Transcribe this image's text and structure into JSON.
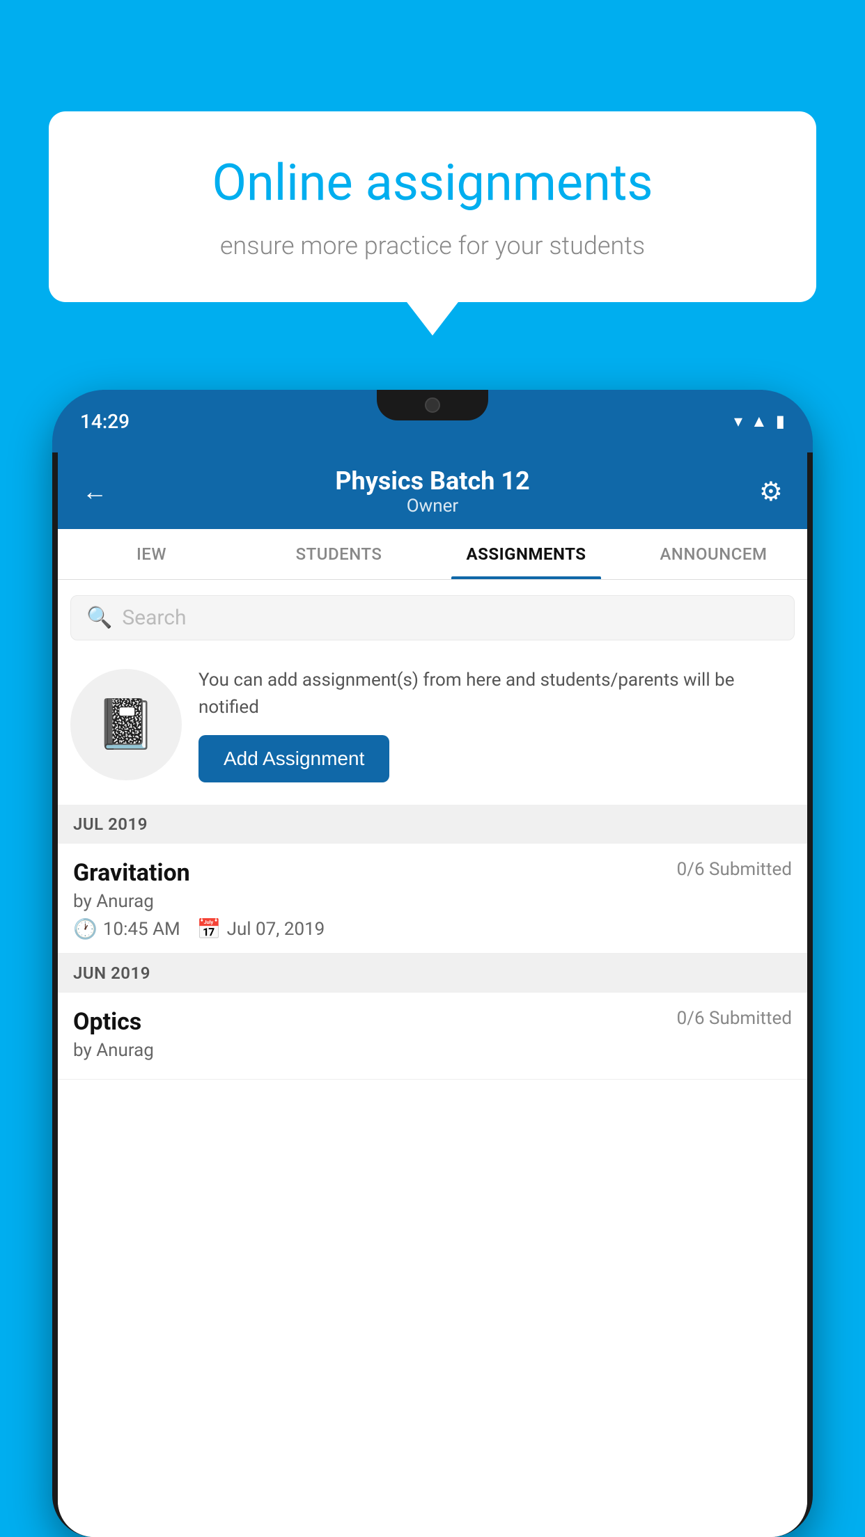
{
  "background_color": "#00AEEF",
  "promo": {
    "title": "Online assignments",
    "subtitle": "ensure more practice for your students"
  },
  "status_bar": {
    "time": "14:29",
    "icons": [
      "wifi",
      "signal",
      "battery"
    ]
  },
  "header": {
    "title": "Physics Batch 12",
    "subtitle": "Owner",
    "back_label": "←",
    "gear_label": "⚙"
  },
  "tabs": [
    {
      "label": "IEW",
      "active": false
    },
    {
      "label": "STUDENTS",
      "active": false
    },
    {
      "label": "ASSIGNMENTS",
      "active": true
    },
    {
      "label": "ANNOUNCEM",
      "active": false
    }
  ],
  "search": {
    "placeholder": "Search"
  },
  "empty_state": {
    "description": "You can add assignment(s) from here and students/parents will be notified",
    "add_button_label": "Add Assignment"
  },
  "sections": [
    {
      "label": "JUL 2019",
      "assignments": [
        {
          "name": "Gravitation",
          "submitted": "0/6 Submitted",
          "by": "by Anurag",
          "time": "10:45 AM",
          "date": "Jul 07, 2019"
        }
      ]
    },
    {
      "label": "JUN 2019",
      "assignments": [
        {
          "name": "Optics",
          "submitted": "0/6 Submitted",
          "by": "by Anurag",
          "time": "",
          "date": ""
        }
      ]
    }
  ]
}
